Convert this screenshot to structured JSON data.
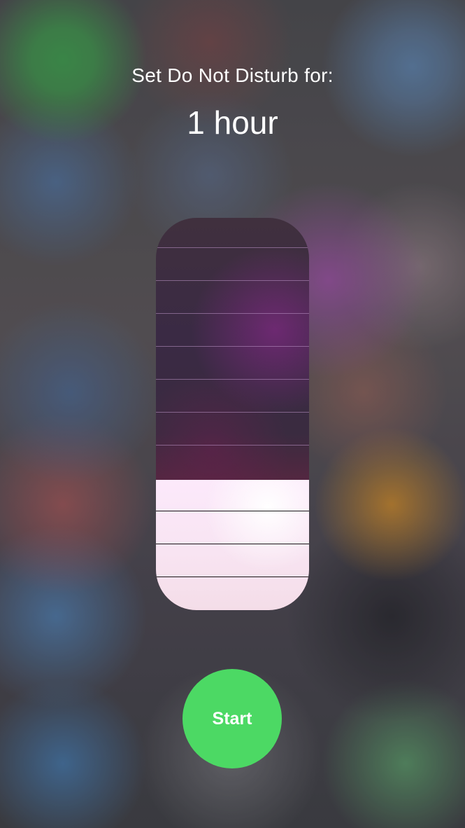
{
  "prompt": {
    "title": "Set Do Not Disturb for:",
    "duration": "1 hour"
  },
  "slider": {
    "segments": 12,
    "filled_segments": 4,
    "fill_fraction": 0.333,
    "track_color": "#3a2b40",
    "fill_color": "#fce9fb"
  },
  "start_button": {
    "label": "Start",
    "color": "#4cd964"
  }
}
